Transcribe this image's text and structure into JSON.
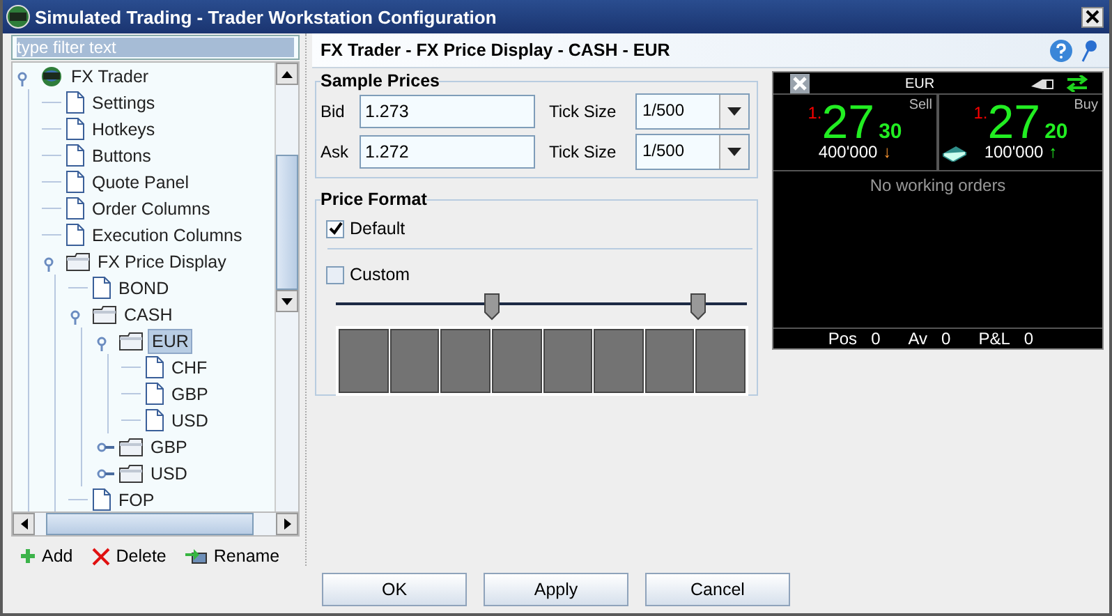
{
  "window": {
    "title": "Simulated Trading - Trader Workstation Configuration"
  },
  "filter": {
    "placeholder": "type filter text"
  },
  "tree": [
    {
      "label": "FX Trader",
      "kind": "root",
      "expanded": true,
      "selected": false,
      "children": [
        {
          "label": "Settings",
          "kind": "page",
          "selected": false
        },
        {
          "label": "Hotkeys",
          "kind": "page",
          "selected": false
        },
        {
          "label": "Buttons",
          "kind": "page",
          "selected": false
        },
        {
          "label": "Quote Panel",
          "kind": "page",
          "selected": false
        },
        {
          "label": "Order Columns",
          "kind": "page",
          "selected": false
        },
        {
          "label": "Execution Columns",
          "kind": "page",
          "selected": false
        },
        {
          "label": "FX Price Display",
          "kind": "folder",
          "expanded": true,
          "selected": false,
          "children": [
            {
              "label": "BOND",
              "kind": "page",
              "selected": false
            },
            {
              "label": "CASH",
              "kind": "folder",
              "expanded": true,
              "selected": false,
              "children": [
                {
                  "label": "EUR",
                  "kind": "folder",
                  "expanded": true,
                  "selected": true,
                  "children": [
                    {
                      "label": "CHF",
                      "kind": "page",
                      "selected": false
                    },
                    {
                      "label": "GBP",
                      "kind": "page",
                      "selected": false
                    },
                    {
                      "label": "USD",
                      "kind": "page",
                      "selected": false
                    }
                  ]
                },
                {
                  "label": "GBP",
                  "kind": "folder",
                  "expanded": false,
                  "selected": false
                },
                {
                  "label": "USD",
                  "kind": "folder",
                  "expanded": false,
                  "selected": false
                }
              ]
            },
            {
              "label": "FOP",
              "kind": "page",
              "selected": false
            }
          ]
        }
      ]
    }
  ],
  "tree_actions": [
    {
      "label": "Add",
      "kind": "add"
    },
    {
      "label": "Delete",
      "kind": "delete"
    },
    {
      "label": "Rename",
      "kind": "rename"
    }
  ],
  "page_title": "FX Trader - FX Price Display - CASH - EUR",
  "sample_prices": {
    "title": "Sample Prices",
    "rows": [
      {
        "label": "Bid",
        "value": "1.273",
        "tick_label": "Tick Size",
        "tick_value": "1/500"
      },
      {
        "label": "Ask",
        "value": "1.272",
        "tick_label": "Tick Size",
        "tick_value": "1/500"
      }
    ]
  },
  "price_format": {
    "title": "Price Format",
    "options": [
      {
        "label": "Default",
        "checked": true
      },
      {
        "label": "Custom",
        "checked": false
      }
    ],
    "slider_thumbs": [
      {
        "level": 0.38
      },
      {
        "level": 0.88
      }
    ],
    "swatches": [
      {
        "color": "#737373"
      },
      {
        "color": "#737373"
      },
      {
        "color": "#737373"
      },
      {
        "color": "#737373"
      },
      {
        "color": "#737373"
      },
      {
        "color": "#737373"
      },
      {
        "color": "#737373"
      },
      {
        "color": "#737373"
      }
    ]
  },
  "preview": {
    "symbol": "EUR",
    "sides": [
      {
        "label": "Sell",
        "prefix": "1.",
        "big": "27",
        "small": "30",
        "size": "400'000",
        "arrow": "↓",
        "kind": "sell"
      },
      {
        "label": "Buy",
        "prefix": "1.",
        "big": "27",
        "small": "20",
        "size": "100'000",
        "arrow": "↑",
        "kind": "buy"
      }
    ],
    "message": "No working orders",
    "footer": [
      {
        "label": "Pos",
        "value": "0"
      },
      {
        "label": "Av",
        "value": "0"
      },
      {
        "label": "P&L",
        "value": "0"
      }
    ]
  },
  "buttons": [
    "OK",
    "Apply",
    "Cancel"
  ]
}
